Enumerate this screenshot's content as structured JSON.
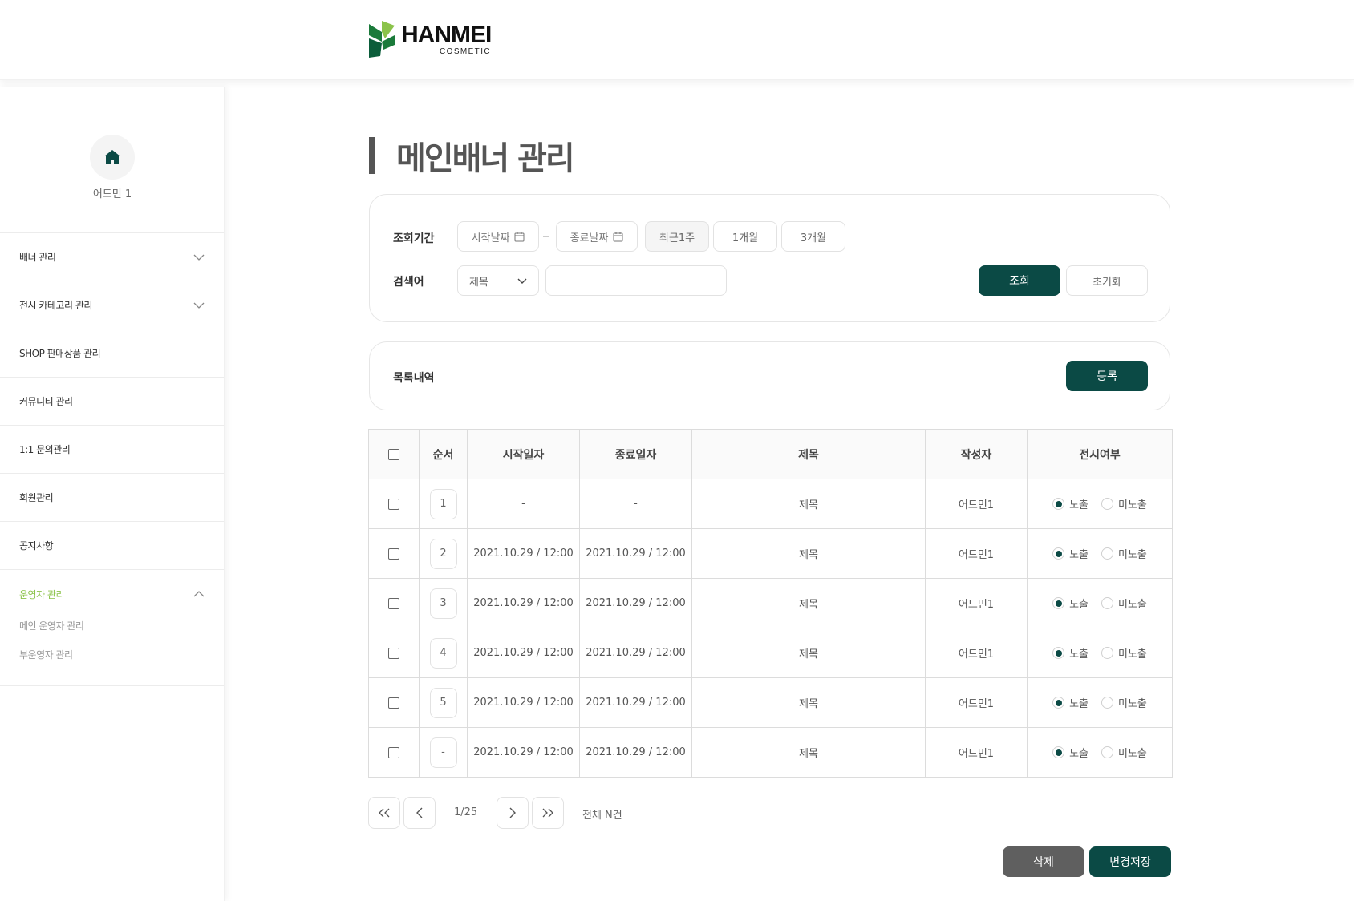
{
  "header": {
    "logo_name": "HANMEI",
    "logo_sub": "COSMETIC"
  },
  "sidebar": {
    "user_name": "어드민 1",
    "items": [
      {
        "label": "배너 관리",
        "chevron": "down"
      },
      {
        "label": "전시 카테고리 관리",
        "chevron": "down"
      },
      {
        "label": "SHOP 판매상품 관리"
      },
      {
        "label": "커뮤니티 관리"
      },
      {
        "label": "1:1 문의관리"
      },
      {
        "label": "회원관리"
      },
      {
        "label": "공지사항"
      },
      {
        "label": "운영자 관리",
        "chevron": "up",
        "active": true
      }
    ],
    "submenu": [
      "메인 운영자 관리",
      "부운영자 관리"
    ]
  },
  "page_title": "메인배너 관리",
  "filter": {
    "period_label": "조회기간",
    "start_date_placeholder": "시작날짜",
    "end_date_placeholder": "종료날짜",
    "quick_ranges": [
      "최근1주",
      "1개월",
      "3개월"
    ],
    "selected_range": "최근1주",
    "keyword_label": "검색어",
    "search_type_value": "제목",
    "keyword_value": "",
    "search_button": "조회",
    "reset_button": "초기화"
  },
  "list": {
    "title": "목록내역",
    "register_button": "등록"
  },
  "table": {
    "columns": [
      "순서",
      "시작일자",
      "종료일자",
      "제목",
      "작성자",
      "전시여부"
    ],
    "display_options": [
      "노출",
      "미노출"
    ],
    "rows": [
      {
        "order": "1",
        "start": "-",
        "end": "-",
        "title": "제목",
        "author": "어드민1",
        "display": "노출"
      },
      {
        "order": "2",
        "start": "2021.10.29 / 12:00",
        "end": "2021.10.29 / 12:00",
        "title": "제목",
        "author": "어드민1",
        "display": "노출"
      },
      {
        "order": "3",
        "start": "2021.10.29 / 12:00",
        "end": "2021.10.29 / 12:00",
        "title": "제목",
        "author": "어드민1",
        "display": "노출"
      },
      {
        "order": "4",
        "start": "2021.10.29 / 12:00",
        "end": "2021.10.29 / 12:00",
        "title": "제목",
        "author": "어드민1",
        "display": "노출"
      },
      {
        "order": "5",
        "start": "2021.10.29 / 12:00",
        "end": "2021.10.29 / 12:00",
        "title": "제목",
        "author": "어드민1",
        "display": "노출"
      },
      {
        "order": "-",
        "start": "2021.10.29 / 12:00",
        "end": "2021.10.29 / 12:00",
        "title": "제목",
        "author": "어드민1",
        "display": "노출"
      }
    ]
  },
  "pagination": {
    "current": "1/25",
    "total_text": "전체 N건"
  },
  "actions": {
    "delete_button": "삭제",
    "save_button": "변경저장"
  },
  "colors": {
    "primary": "#0b4a45",
    "active_menu": "#8bc34a",
    "delete_button": "#5f5f5f"
  }
}
